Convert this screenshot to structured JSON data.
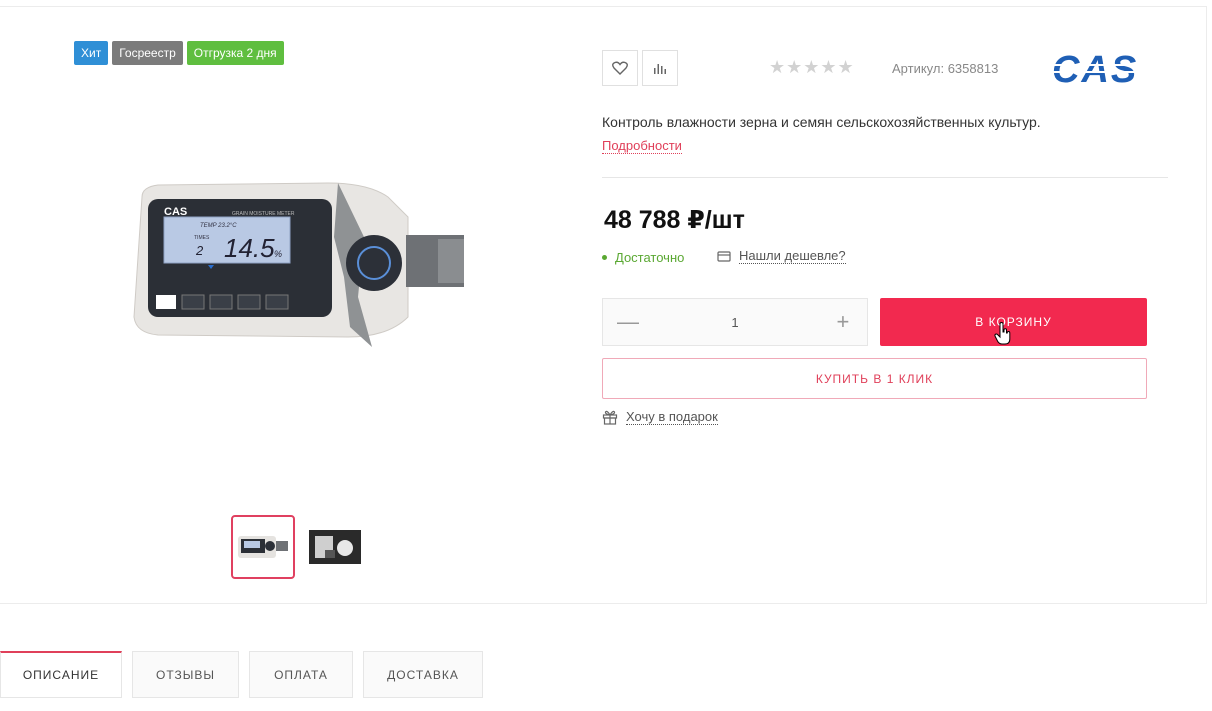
{
  "badges": {
    "hit": "Хит",
    "registry": "Госреестр",
    "shipping": "Отгрузка 2 дня"
  },
  "product": {
    "rating_stars": "★★★★★",
    "rating_value": 0,
    "sku": "Артикул: 6358813",
    "brand": "CAS",
    "description": "Контроль влажности зерна и семян сельскохозяйственных культур.",
    "more_link": "Подробности",
    "price": "48 788 ₽/шт",
    "stock_status": "Достаточно",
    "found_cheaper": "Нашли дешевле?",
    "quantity": "1",
    "qty_minus": "—",
    "qty_plus": "+",
    "add_to_cart": "В КОРЗИНУ",
    "buy_one_click": "КУПИТЬ В 1 КЛИК",
    "gift": "Хочу в подарок"
  },
  "device_screen": {
    "brand": "CAS",
    "temp": "TEMP 23.2°C",
    "times": "TIMES",
    "count": "2",
    "reading": "14.5",
    "unit": "%",
    "title": "GRAIN MOISTURE METER"
  },
  "tabs": [
    {
      "label": "ОПИСАНИЕ"
    },
    {
      "label": "ОТЗЫВЫ"
    },
    {
      "label": "ОПЛАТА"
    },
    {
      "label": "ДОСТАВКА"
    }
  ],
  "colors": {
    "accent": "#f2294f",
    "stock": "#5aa832",
    "badge_hit": "#2f8fd6",
    "badge_registry": "#7b7b7b",
    "badge_shipping": "#5fbe3f"
  }
}
